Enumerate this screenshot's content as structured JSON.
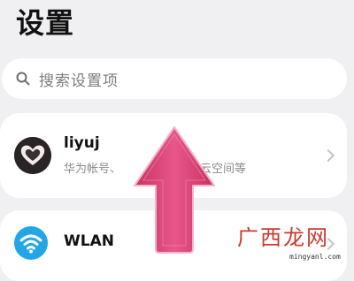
{
  "page": {
    "title": "设置"
  },
  "search": {
    "placeholder": "搜索设置项",
    "icon": "search-icon"
  },
  "account": {
    "name": "liyuj",
    "subtitle_left": "华为帐号、",
    "subtitle_right": "云空间等",
    "icon": "avatar-heart"
  },
  "wlan": {
    "label": "WLAN",
    "icon": "wifi-icon"
  },
  "overlay": {
    "arrow_color": "#e04a7a"
  },
  "watermark": {
    "text": "广西龙网",
    "url": "mingyanl.com"
  },
  "colors": {
    "background": "#f0f0f2",
    "card": "#ffffff",
    "wifi_blue": "#23a6e6"
  }
}
